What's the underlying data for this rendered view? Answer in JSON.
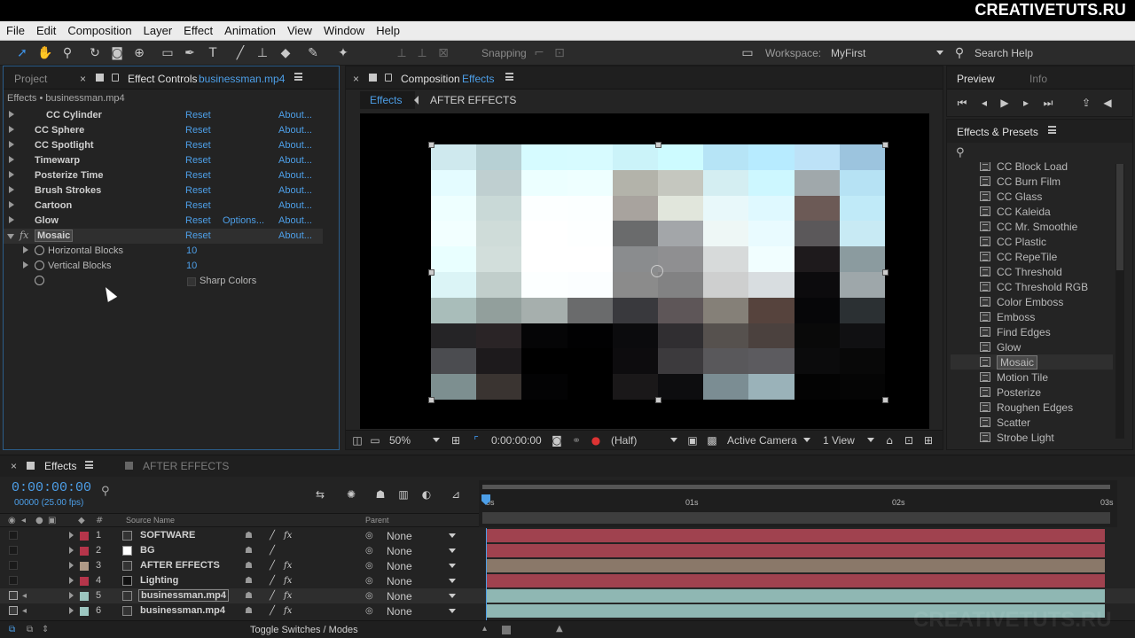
{
  "brand": "CREATIVETUTS.RU",
  "watermark": "CREATIVETUTS.RU",
  "menu": [
    "File",
    "Edit",
    "Composition",
    "Layer",
    "Effect",
    "Animation",
    "View",
    "Window",
    "Help"
  ],
  "toolbar": {
    "snapping": "Snapping",
    "workspace_label": "Workspace:",
    "workspace_value": "MyFirst",
    "search_help": "Search Help"
  },
  "effect_controls": {
    "tab_project": "Project",
    "tab_title": "Effect Controls",
    "tab_file": "businessman.mp4",
    "breadcrumb": "Effects • businessman.mp4",
    "reset_label": "Reset",
    "about_label": "About...",
    "options_label": "Options...",
    "effects": [
      {
        "name": "CC Cylinder"
      },
      {
        "name": "CC Sphere"
      },
      {
        "name": "CC Spotlight"
      },
      {
        "name": "Timewarp"
      },
      {
        "name": "Posterize Time"
      },
      {
        "name": "Brush Strokes"
      },
      {
        "name": "Cartoon"
      },
      {
        "name": "Glow"
      },
      {
        "name": "Mosaic"
      }
    ],
    "mosaic_props": {
      "horizontal_label": "Horizontal Blocks",
      "horizontal_value": "10",
      "vertical_label": "Vertical Blocks",
      "vertical_value": "10",
      "sharp_colors_label": "Sharp Colors"
    }
  },
  "composition": {
    "tab_label": "Composition",
    "tab_name": "Effects",
    "crumb_active": "Effects",
    "crumb_other": "AFTER EFFECTS",
    "footer": {
      "zoom": "50%",
      "timecode": "0:00:00:00",
      "resolution": "(Half)",
      "camera": "Active Camera",
      "views": "1 View"
    },
    "mosaic_colors": [
      [
        "#cfe9ee",
        "#b7d0d4",
        "#d6fbff",
        "#d7fbff",
        "#cbf3f9",
        "#cdfbff",
        "#b6e4f6",
        "#b7ebff",
        "#bde2f7",
        "#9cc4de"
      ],
      [
        "#e4fcff",
        "#bfcfd0",
        "#ecffff",
        "#eeffff",
        "#b3b3aa",
        "#c5c7bf",
        "#d4eef2",
        "#cdf7ff",
        "#a0a8ab",
        "#b6e2f4"
      ],
      [
        "#eeffff",
        "#c9d9d7",
        "#fcffff",
        "#fbffff",
        "#a8a39e",
        "#e1e6dc",
        "#e8f8fa",
        "#dff9ff",
        "#6c5a56",
        "#c0eaf8"
      ],
      [
        "#f2ffff",
        "#cfdcd9",
        "#ffffff",
        "#fdffff",
        "#6a6b6c",
        "#a3a6a9",
        "#eef7f6",
        "#e9fbff",
        "#5b585a",
        "#c8eaf4"
      ],
      [
        "#e9ffff",
        "#d2dedb",
        "#ffffff",
        "#ffffff",
        "#8a8c8e",
        "#8f8f91",
        "#d7dada",
        "#f1feff",
        "#1e1a1c",
        "#8b9b9f"
      ],
      [
        "#dbf4f6",
        "#c1cecb",
        "#fcffff",
        "#fbfeff",
        "#8b8b8b",
        "#828283",
        "#cecfcf",
        "#d8dde0",
        "#0c0b0d",
        "#9ea7aa"
      ],
      [
        "#a9bdba",
        "#929f9c",
        "#a6afad",
        "#6a6b6c",
        "#39393d",
        "#5e5658",
        "#858078",
        "#56433d",
        "#060608",
        "#2b3033"
      ],
      [
        "#252426",
        "#2a2426",
        "#050506",
        "#010102",
        "#0b0b0d",
        "#302e31",
        "#56514e",
        "#4b413e",
        "#090909",
        "#101012"
      ],
      [
        "#4b4c50",
        "#1d1a1c",
        "#000000",
        "#000000",
        "#0d0c0e",
        "#3c3a3d",
        "#59585b",
        "#5c5b5f",
        "#0b0b0c",
        "#080808"
      ],
      [
        "#7d8f90",
        "#3a3431",
        "#030304",
        "#000000",
        "#1a1819",
        "#0d0d0f",
        "#7b8d93",
        "#9ab2b9",
        "#030303",
        "#050505"
      ]
    ]
  },
  "preview": {
    "tab_preview": "Preview",
    "tab_info": "Info"
  },
  "effects_presets": {
    "title": "Effects & Presets",
    "items": [
      "CC Block Load",
      "CC Burn Film",
      "CC Glass",
      "CC Kaleida",
      "CC Mr. Smoothie",
      "CC Plastic",
      "CC RepeTile",
      "CC Threshold",
      "CC Threshold RGB",
      "Color Emboss",
      "Emboss",
      "Find Edges",
      "Glow",
      "Mosaic",
      "Motion Tile",
      "Posterize",
      "Roughen Edges",
      "Scatter",
      "Strobe Light"
    ],
    "selected": "Mosaic"
  },
  "timeline": {
    "tab_active": "Effects",
    "tab_other": "AFTER EFFECTS",
    "timecode": "0:00:00:00",
    "fps": "00000 (25.00 fps)",
    "col_source": "Source Name",
    "col_parent": "Parent",
    "ruler": [
      "0s",
      "01s",
      "02s",
      "03s"
    ],
    "toggle_label": "Toggle Switches / Modes",
    "layers": [
      {
        "num": "1",
        "name": "SOFTWARE",
        "parent": "None",
        "label_color": "#b5354a",
        "bar_color": "#a0424f"
      },
      {
        "num": "2",
        "name": "BG",
        "parent": "None",
        "label_color": "#b5354a",
        "bar_color": "#a0424f"
      },
      {
        "num": "3",
        "name": "AFTER EFFECTS",
        "parent": "None",
        "label_color": "#b09a87",
        "bar_color": "#8a7869"
      },
      {
        "num": "4",
        "name": "Lighting",
        "parent": "None",
        "label_color": "#b5354a",
        "bar_color": "#a0424f"
      },
      {
        "num": "5",
        "name": "businessman.mp4",
        "parent": "None",
        "label_color": "#9cc6c0",
        "bar_color": "#8fb7b3"
      },
      {
        "num": "6",
        "name": "businessman.mp4",
        "parent": "None",
        "label_color": "#9cc6c0",
        "bar_color": "#8fb7b3"
      }
    ]
  }
}
